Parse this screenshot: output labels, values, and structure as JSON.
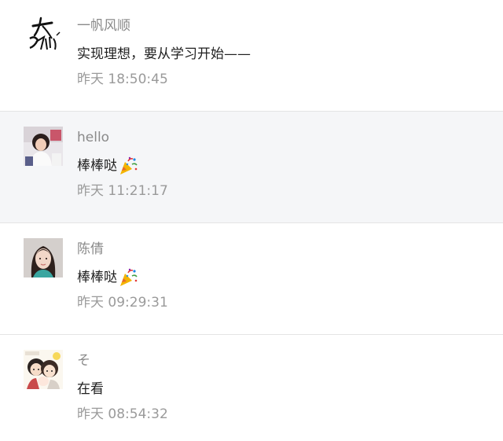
{
  "comments": [
    {
      "avatar_icon": "calligraphy-avatar",
      "username": "一帆风顺",
      "message": "实现理想，要从学习开始——",
      "timestamp": "昨天 18:50:45",
      "highlighted": false,
      "emoji": ""
    },
    {
      "avatar_icon": "child-photo-avatar",
      "username": "hello",
      "message": "棒棒哒",
      "timestamp": "昨天 11:21:17",
      "highlighted": true,
      "emoji": "party-popper-icon"
    },
    {
      "avatar_icon": "girl-photo-avatar",
      "username": "陈倩",
      "message": "棒棒哒",
      "timestamp": "昨天 09:29:31",
      "highlighted": false,
      "emoji": "party-popper-icon"
    },
    {
      "avatar_icon": "cartoon-family-avatar",
      "username": "そ",
      "message": "在看",
      "timestamp": "昨天 08:54:32",
      "highlighted": false,
      "emoji": ""
    }
  ]
}
